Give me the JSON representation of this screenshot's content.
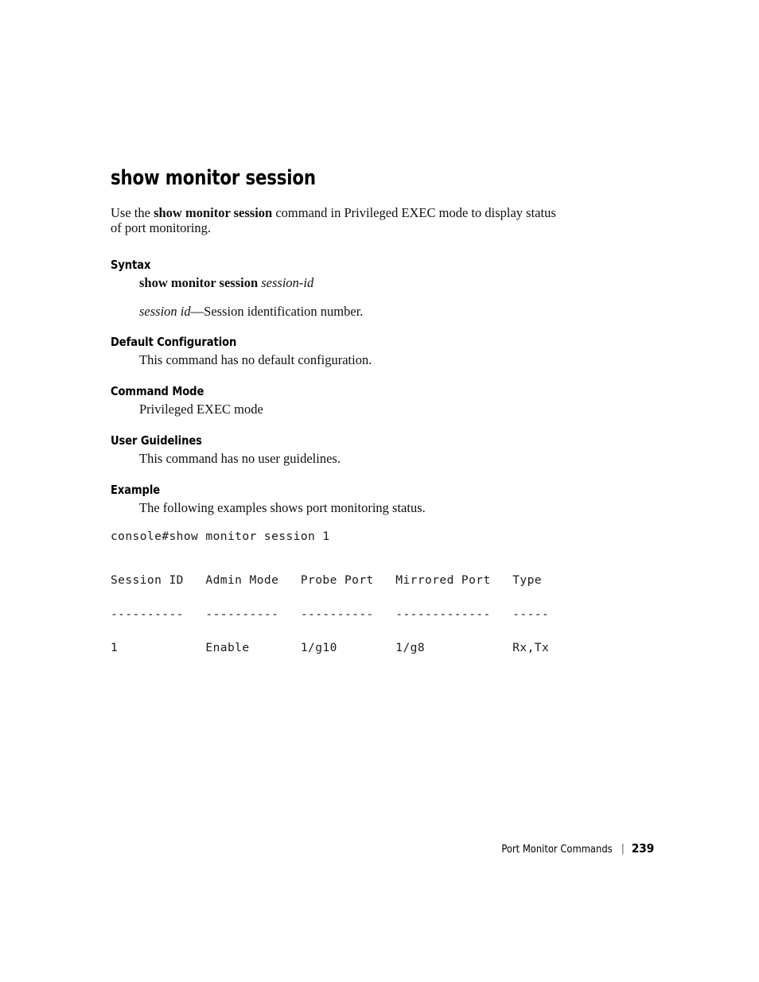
{
  "page": {
    "title": "show monitor session",
    "number": "239",
    "footer_label": "Port Monitor Commands",
    "footer_separator": "|"
  },
  "intro": {
    "before": "Use the ",
    "command": "show monitor session",
    "after": " command in Privileged EXEC mode to display status of port monitoring."
  },
  "sections": [
    {
      "heading": "Syntax",
      "syntax_command": "show monitor session ",
      "syntax_arg": "session-id",
      "param_term": "session id",
      "param_desc": "—Session identification number."
    },
    {
      "heading": "Default Configuration",
      "body": "This command has no default configuration."
    },
    {
      "heading": "Command Mode",
      "body": "Privileged EXEC mode"
    },
    {
      "heading": "User Guidelines",
      "body": "This command has no user guidelines."
    },
    {
      "heading": "Example",
      "body": "The following examples shows port monitoring status."
    }
  ],
  "console": {
    "command_line": "console#show monitor session 1",
    "header_line": "Session ID   Admin Mode   Probe Port   Mirrored Port   Type",
    "separator_line": "----------   ----------   ----------   -------------   -----",
    "data_line": "1            Enable       1/g10        1/g8            Rx,Tx",
    "columns": [
      "Session ID",
      "Admin Mode",
      "Probe Port",
      "Mirrored Port",
      "Type"
    ],
    "rows": [
      {
        "session_id": "1",
        "admin_mode": "Enable",
        "probe_port": "1/g10",
        "mirrored_port": "1/g8",
        "type": "Rx,Tx"
      }
    ]
  }
}
